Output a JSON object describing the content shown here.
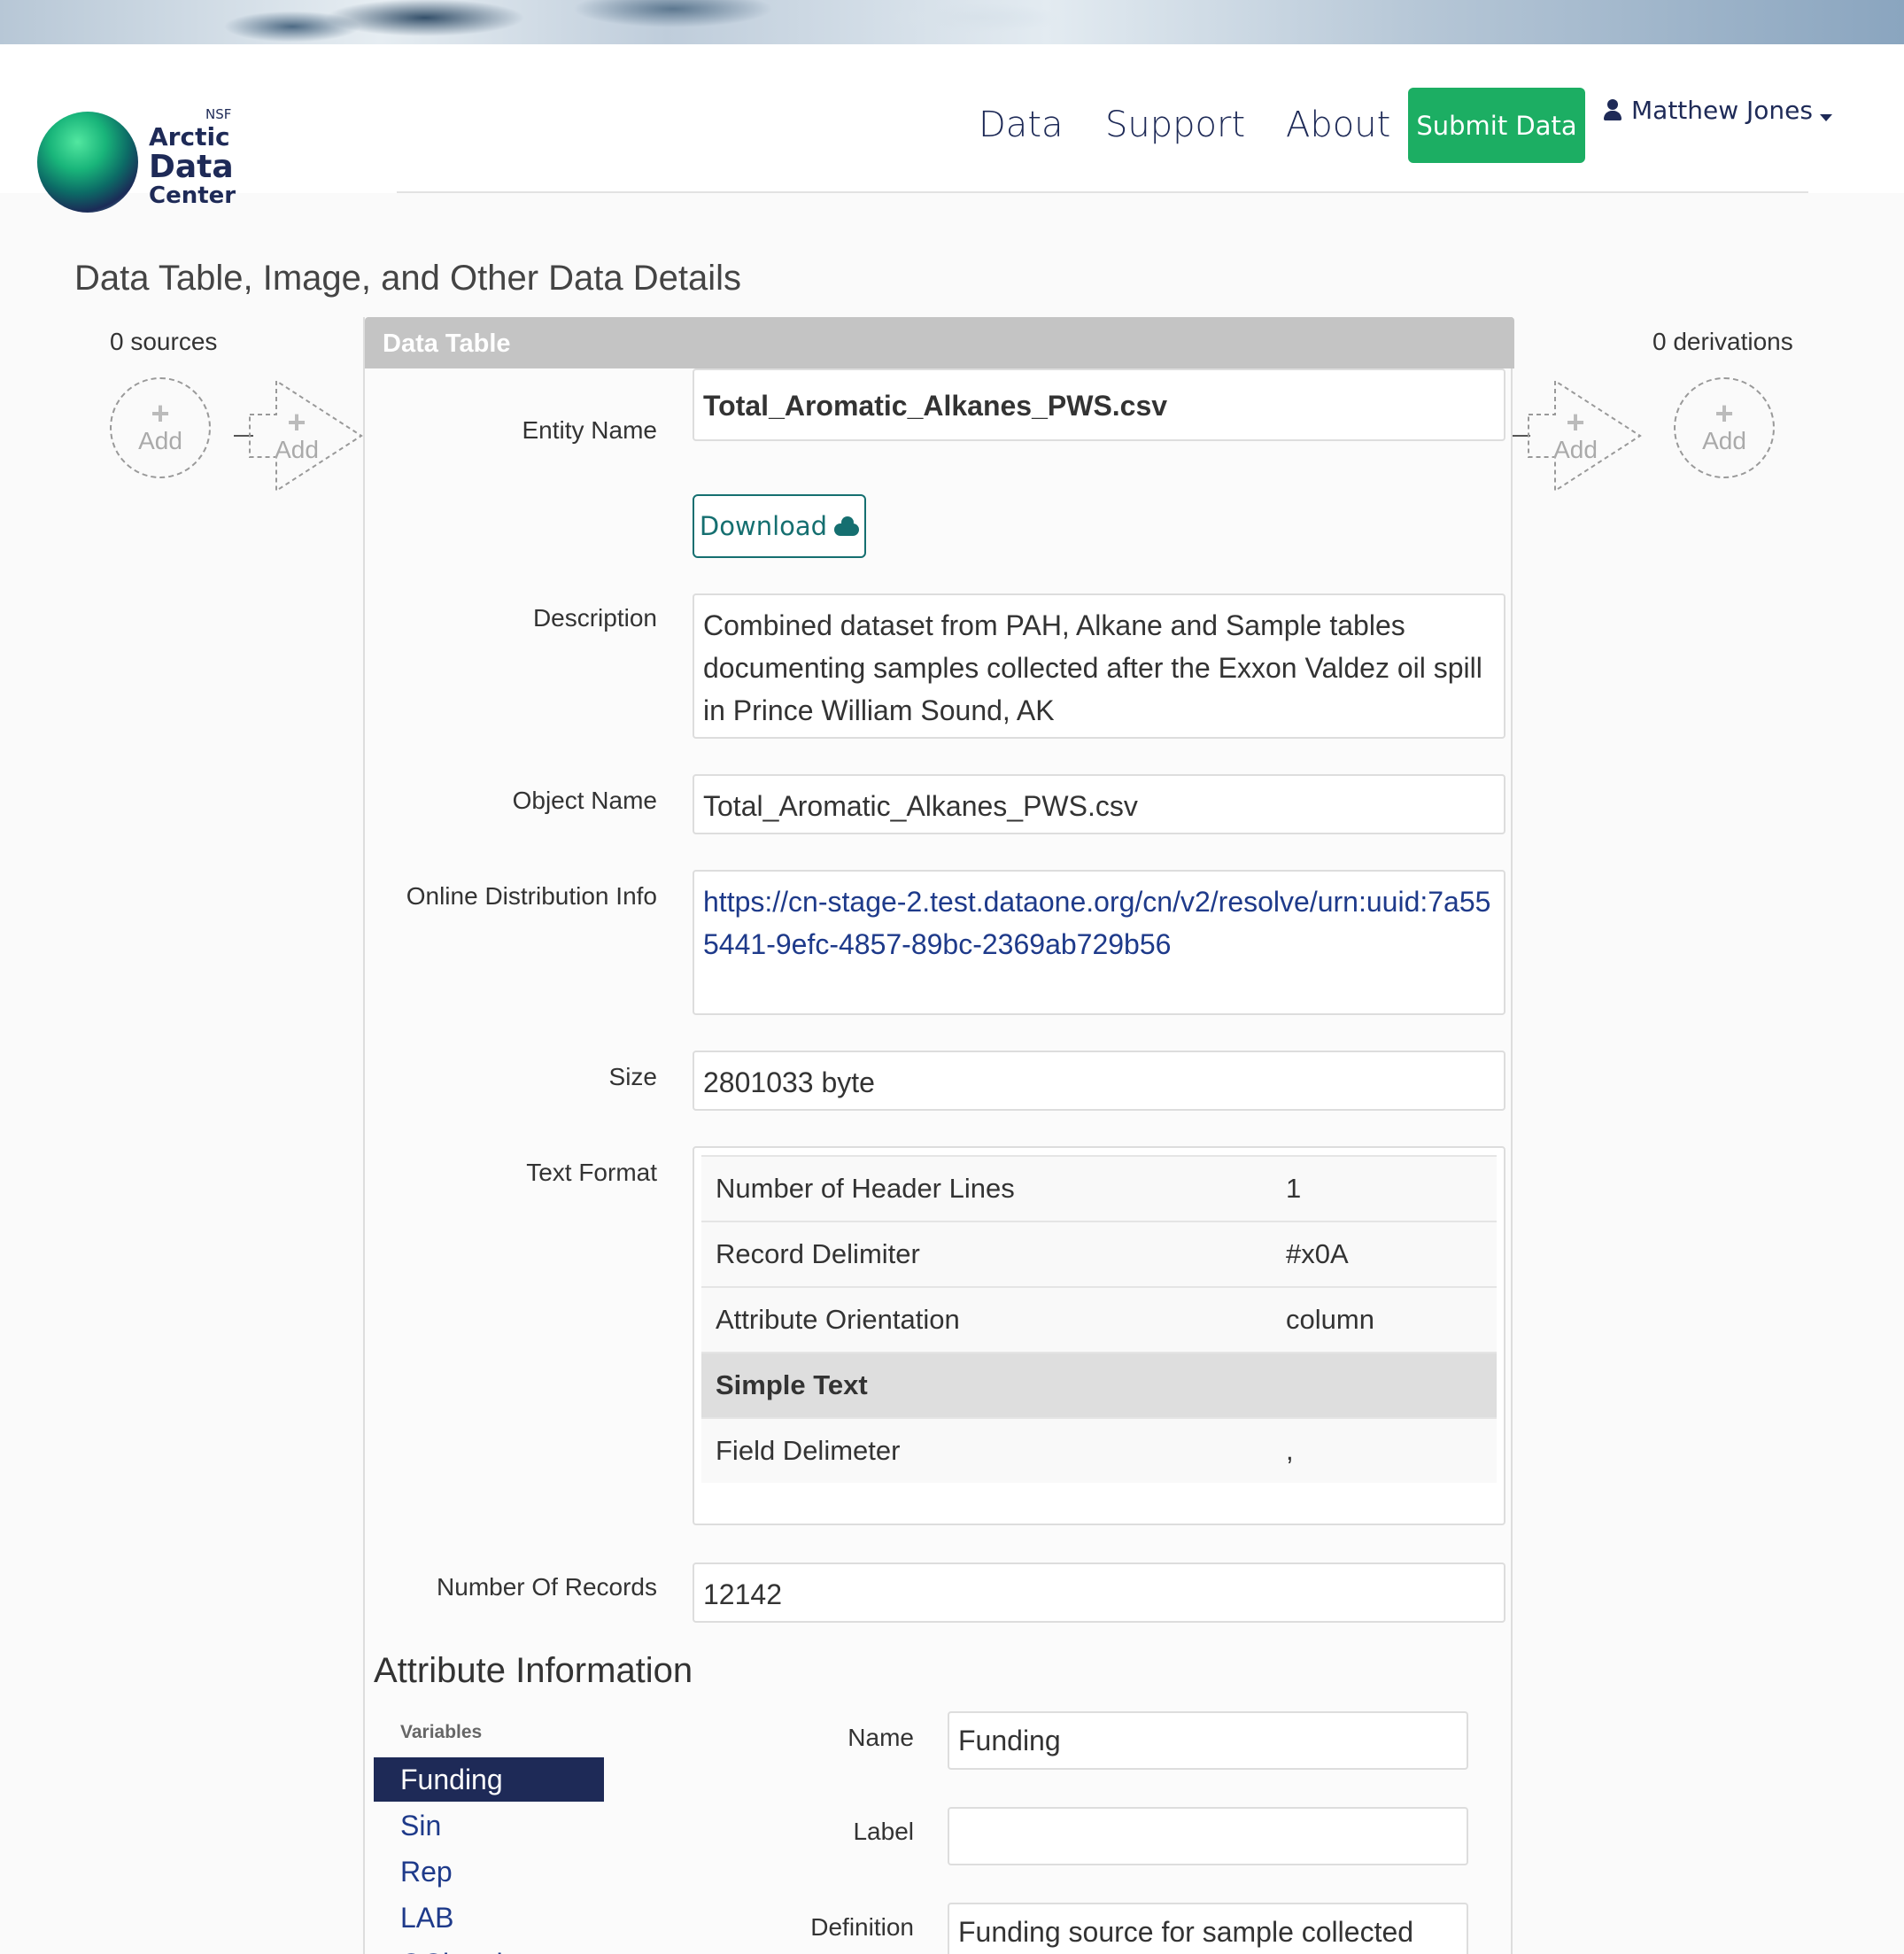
{
  "header": {
    "logo": {
      "nsf": "NSF",
      "line1": "Arctic",
      "line2": "Data",
      "line3": "Center"
    },
    "nav": [
      "Data",
      "Support",
      "About"
    ],
    "submit_label": "Submit Data",
    "user_name": "Matthew Jones"
  },
  "page_title": "Data Table, Image, and Other Data Details",
  "provenance": {
    "sources_label": "0 sources",
    "derivations_label": "0 derivations",
    "add_label": "Add"
  },
  "panel": {
    "title": "Data Table",
    "entity_name_label": "Entity Name",
    "entity_name": "Total_Aromatic_Alkanes_PWS.csv",
    "download_label": "Download",
    "description_label": "Description",
    "description": "Combined dataset from PAH, Alkane and Sample tables documenting samples collected after the Exxon Valdez oil spill in Prince William Sound, AK",
    "object_name_label": "Object Name",
    "object_name": "Total_Aromatic_Alkanes_PWS.csv",
    "online_dist_label": "Online Distribution Info",
    "online_dist_url": "https://cn-stage-2.test.dataone.org/cn/v2/resolve/urn:uuid:7a555441-9efc-4857-89bc-2369ab729b56",
    "size_label": "Size",
    "size": "2801033 byte",
    "text_format_label": "Text Format",
    "text_format": {
      "rows": [
        {
          "key": "Number of Header Lines",
          "value": "1"
        },
        {
          "key": "Record Delimiter",
          "value": "#x0A"
        },
        {
          "key": "Attribute Orientation",
          "value": "column"
        }
      ],
      "section": "Simple Text",
      "field_delim_key": "Field Delimeter",
      "field_delim_value": ","
    },
    "num_records_label": "Number Of Records",
    "num_records": "12142"
  },
  "attributes": {
    "title": "Attribute Information",
    "variables_label": "Variables",
    "variables": [
      "Funding",
      "Sin",
      "Rep",
      "LAB",
      "QCbatch"
    ],
    "name_label": "Name",
    "name_value": "Funding",
    "label_label": "Label",
    "label_value": "",
    "definition_label": "Definition",
    "definition_value": "Funding source for sample collected"
  },
  "colors": {
    "brand_navy": "#1e2a57",
    "submit_green": "#1cae63",
    "download_teal": "#156f70",
    "link_blue": "#1e3a8a"
  }
}
